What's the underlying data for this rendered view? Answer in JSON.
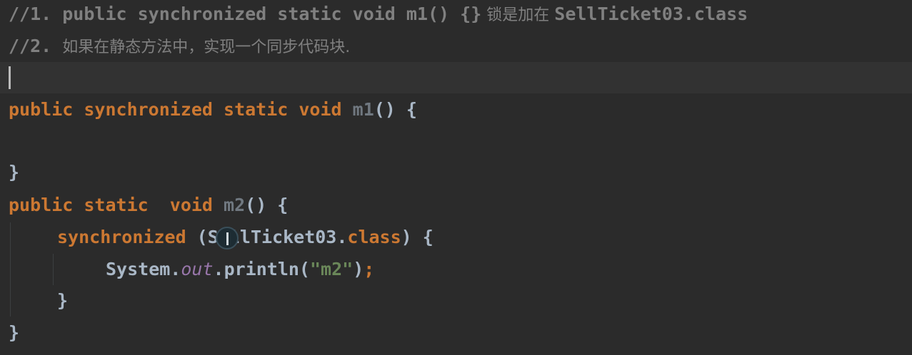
{
  "editor": {
    "colors": {
      "background": "#2b2b2b",
      "comment": "#808080",
      "keyword": "#cc7832",
      "text": "#a9b7c6",
      "field": "#9876aa",
      "string": "#6a8759"
    },
    "line1": {
      "code": "//1. public synchronized static void m1() {}",
      "cjk": " 锁是加在 ",
      "tail": "SellTicket03.class"
    },
    "line2": {
      "prefix": "//2. ",
      "cjk": "如果在静态方法中，实现一个同步代码块."
    },
    "line4": {
      "kw": "public synchronized static void ",
      "name": "m1",
      "rest": "() {"
    },
    "line6": {
      "text": "}"
    },
    "line7": {
      "kw1": "public static  void ",
      "name": "m2",
      "rest": "() {"
    },
    "line8": {
      "kw": "synchronized ",
      "paren": "(",
      "cls": "SellTicket03.",
      "kw2": "class",
      "rest": ") {"
    },
    "line9": {
      "obj": "System.",
      "field": "out",
      "call": ".println(",
      "str": "\"m2\"",
      "close": ")",
      "semi": ";"
    },
    "line10": {
      "text": "}"
    },
    "line11": {
      "text": "}"
    }
  }
}
